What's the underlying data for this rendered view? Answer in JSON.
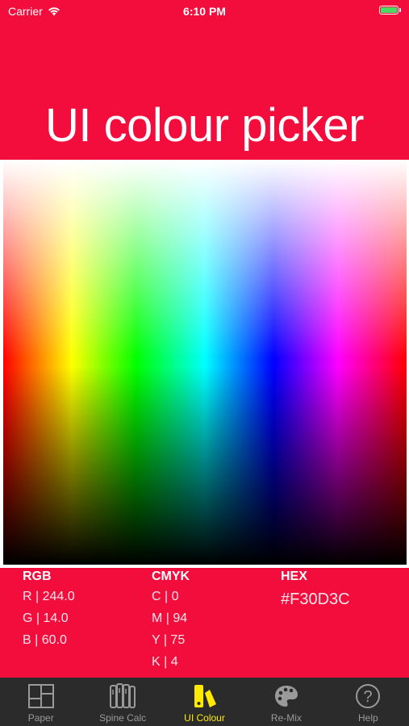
{
  "status_bar": {
    "carrier": "Carrier",
    "time": "6:10 PM"
  },
  "header": {
    "title": "UI colour picker"
  },
  "values": {
    "rgb": {
      "heading": "RGB",
      "r": "R | 244.0",
      "g": "G | 14.0",
      "b": "B | 60.0"
    },
    "cmyk": {
      "heading": "CMYK",
      "c": "C | 0",
      "m": "M | 94",
      "y": "Y  | 75",
      "k": "K  | 4"
    },
    "hex": {
      "heading": "HEX",
      "value": "#F30D3C"
    }
  },
  "colors": {
    "accent": "#F30D3C",
    "tab_active": "#ffea00",
    "tab_inactive": "#9a9a9a",
    "tabbar_bg": "#2b2b2b"
  },
  "tabs": [
    {
      "label": "Paper",
      "icon": "paper-layout-icon"
    },
    {
      "label": "Spine Calc",
      "icon": "spine-calc-icon"
    },
    {
      "label": "UI Colour",
      "icon": "ui-colour-icon",
      "active": true
    },
    {
      "label": "Re-Mix",
      "icon": "palette-icon"
    },
    {
      "label": "Help",
      "icon": "help-icon"
    }
  ]
}
